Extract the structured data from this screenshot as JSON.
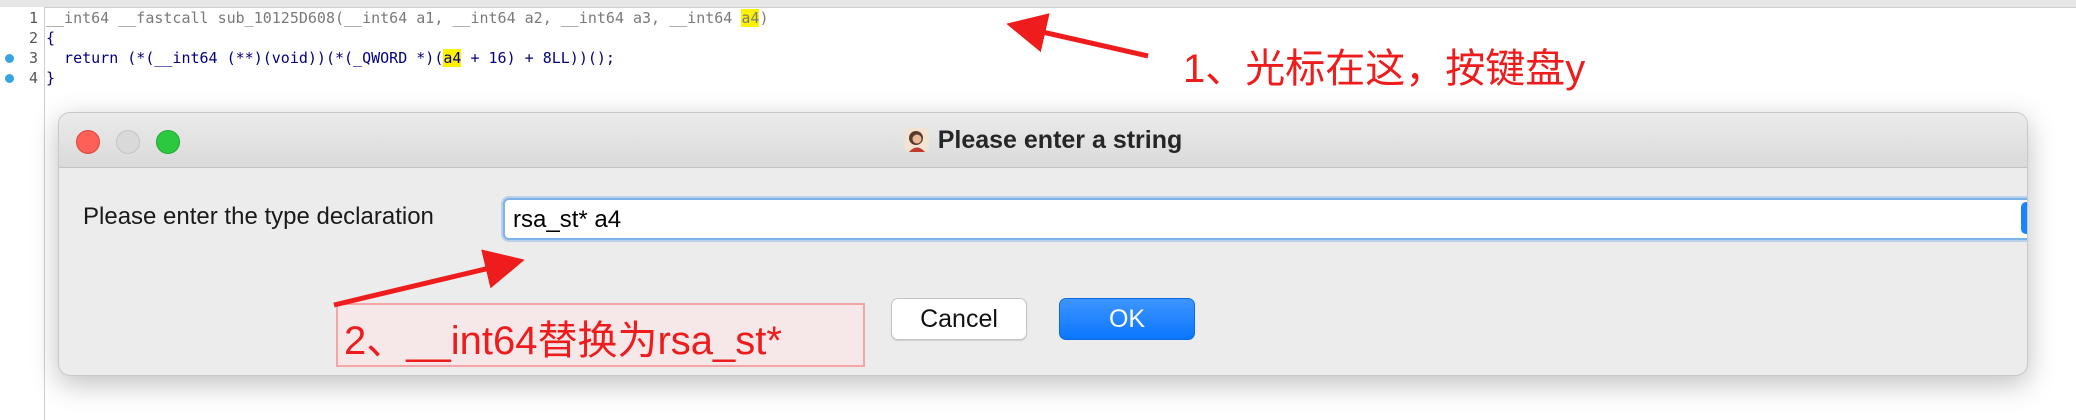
{
  "code": {
    "lines": [
      {
        "num": "1",
        "pre": "__int64 __fastcall sub_10125D608(__int64 a1, __int64 a2, __int64 a3, __int64 ",
        "hl": "a4",
        "post": ")"
      },
      {
        "num": "2",
        "text": "{"
      },
      {
        "num": "3",
        "pre": "  return (*(__int64 (**)(void))(*(_QWORD *)(",
        "hl": "a4",
        "post": " + 16) + 8LL))();"
      },
      {
        "num": "4",
        "text": "}"
      }
    ]
  },
  "dialog": {
    "title": "Please enter a string",
    "field_label": "Please enter the type declaration",
    "field_value": "rsa_st* a4",
    "cancel_label": "Cancel",
    "ok_label": "OK"
  },
  "annotations": {
    "step1": "1、光标在这，按键盘y",
    "step2": "2、__int64替换为rsa_st*"
  },
  "colors": {
    "annotation": "#ee1c1c",
    "highlight": "#fff200",
    "accent": "#1a84ff"
  }
}
